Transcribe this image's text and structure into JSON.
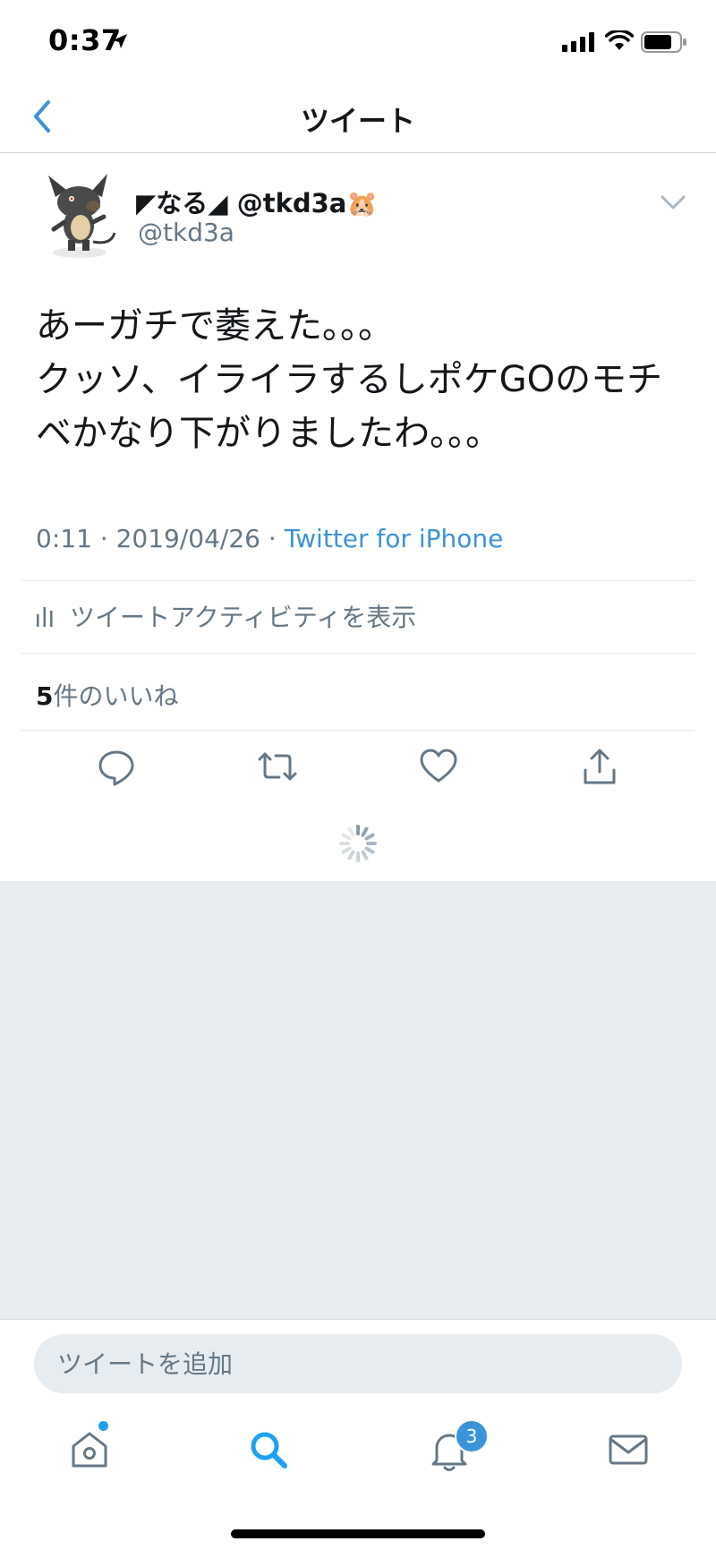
{
  "status_bar": {
    "time": "0:37"
  },
  "nav": {
    "title": "ツイート"
  },
  "tweet": {
    "display_name": "◤なる◢ @tkd3a",
    "name_emoji": "🐹",
    "handle": "@tkd3a",
    "text": "あーガチで萎えた。。。\nクッソ、イライラするしポケGOのモチベかなり下がりましたわ。。。",
    "time": "0:11",
    "date": "2019/04/26",
    "separator": " · ",
    "source": "Twitter for iPhone",
    "activity_label": "ツイートアクティビティを表示",
    "likes_count": "5",
    "likes_label": "件のいいね"
  },
  "reply": {
    "placeholder": "ツイートを追加"
  },
  "tabs": {
    "notifications_badge": "3"
  },
  "colors": {
    "accent": "#1da1f2",
    "text": "#14171a",
    "secondary": "#657786",
    "background_gray": "#e6ecf0"
  }
}
